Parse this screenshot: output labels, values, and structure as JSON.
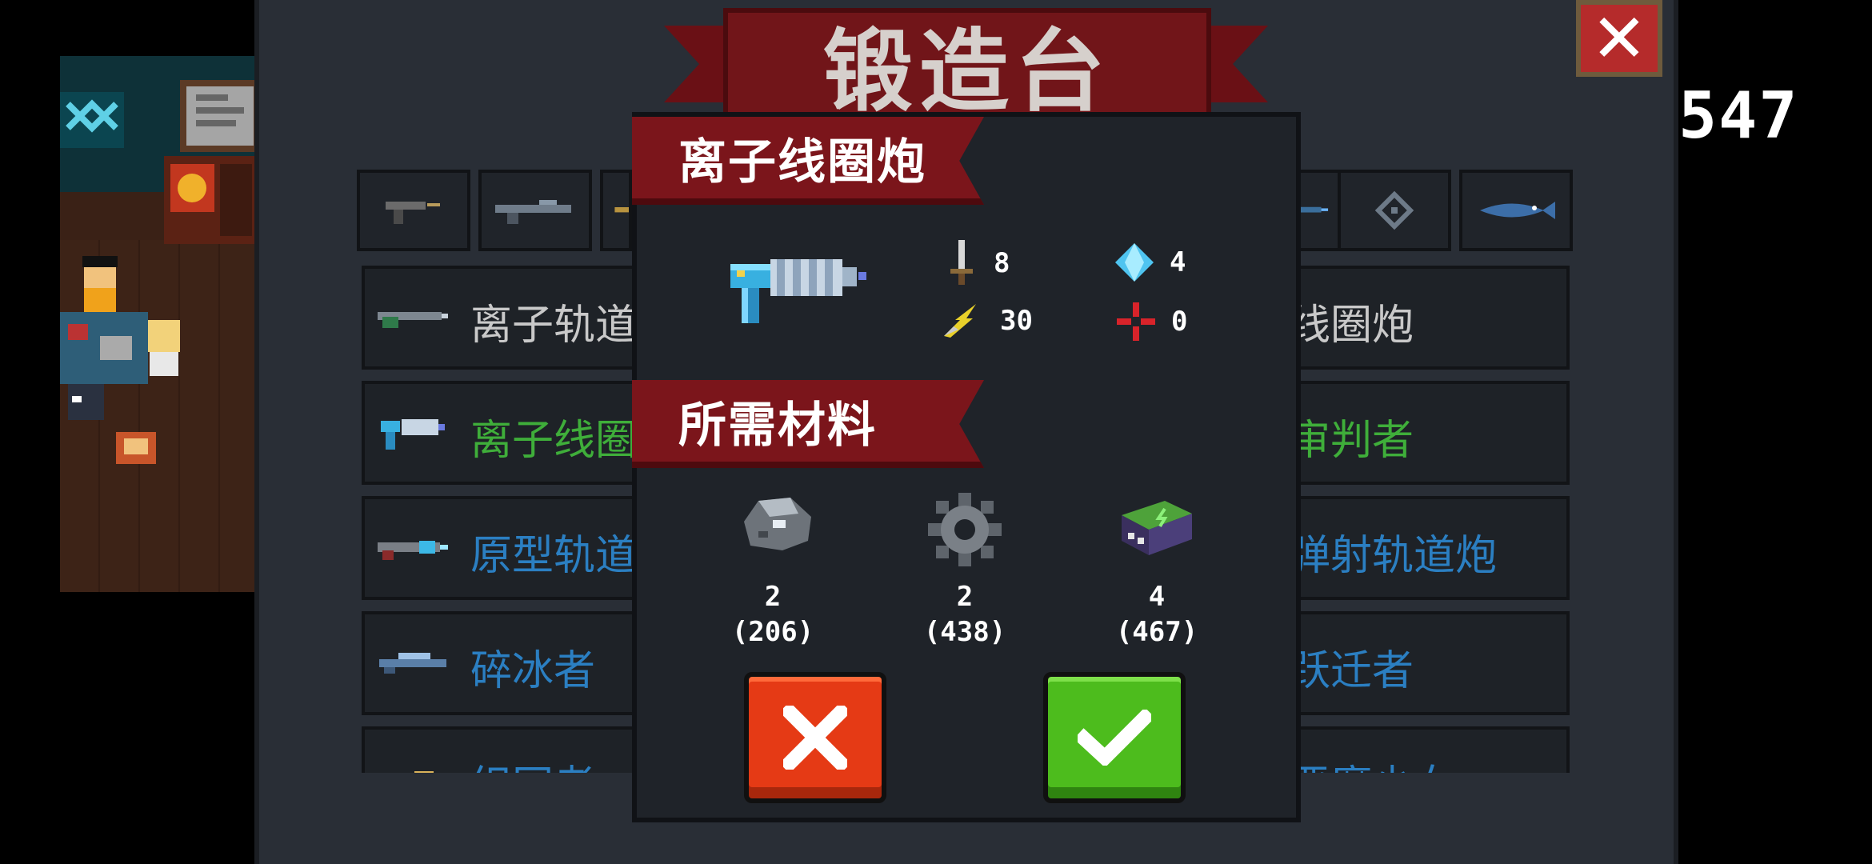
{
  "forge": {
    "title": "锻造台",
    "close_glyph": "✕",
    "score": "547",
    "tabs": [
      "pistol-icon",
      "rifle-icon",
      "shotgun-icon",
      "blank",
      "blank",
      "blank",
      "blank",
      "blank",
      "blank",
      "laser-icon",
      "crosshair-icon",
      "fish-gun-icon"
    ],
    "rows": [
      {
        "left": "离子轨道",
        "right": "线圈炮",
        "left_color": "#c9c9c9",
        "right_color": "#c9c9c9"
      },
      {
        "left": "离子线圈",
        "right": "审判者",
        "left_color": "#3fae3a",
        "right_color": "#3fae3a"
      },
      {
        "left": "原型轨道",
        "right": "弹射轨道炮",
        "left_color": "#2b7fc2",
        "right_color": "#2b7fc2"
      },
      {
        "left": "碎冰者",
        "right": "跃迁者",
        "left_color": "#2b7fc2",
        "right_color": "#2b7fc2"
      },
      {
        "left": "织网者",
        "right": "恶魔少女",
        "left_color": "#2b7fc2",
        "right_color": "#2b7fc2"
      }
    ]
  },
  "popup": {
    "weapon_name": "离子线圈炮",
    "stats": {
      "damage": "8",
      "energy": "4",
      "crit": "30",
      "accuracy": "0"
    },
    "materials_title": "所需材料",
    "materials": [
      {
        "icon": "ore-icon",
        "required": "2",
        "owned": "(206)"
      },
      {
        "icon": "gear-icon",
        "required": "2",
        "owned": "(438)"
      },
      {
        "icon": "battery-icon",
        "required": "4",
        "owned": "(467)"
      }
    ],
    "cancel_glyph": "✕",
    "confirm_glyph": "✔"
  }
}
